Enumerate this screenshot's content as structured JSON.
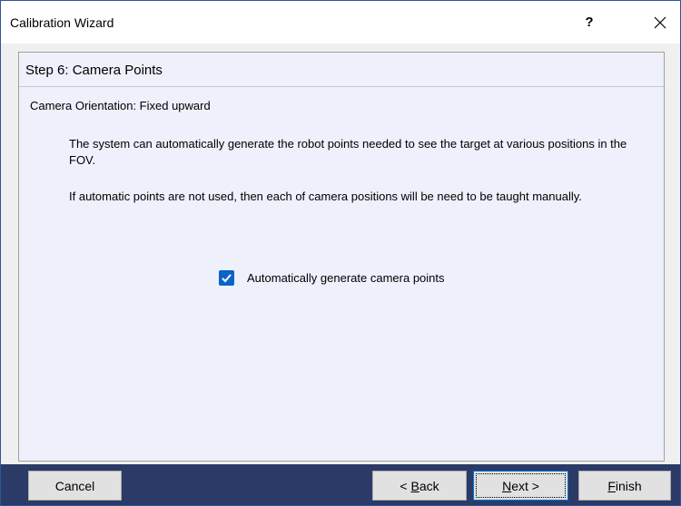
{
  "window": {
    "title": "Calibration Wizard",
    "help_label": "?",
    "close_icon": "close-icon"
  },
  "step": {
    "title": "Step 6: Camera Points",
    "orientation": "Camera Orientation: Fixed upward",
    "paragraph1": "The system can automatically generate the robot points needed to see the target at various positions in the FOV.",
    "paragraph2": "If automatic points are not used, then each of camera positions will be need to be taught manually."
  },
  "options": {
    "auto_generate": {
      "label": "Automatically generate camera points",
      "checked": true
    }
  },
  "buttons": {
    "cancel": "Cancel",
    "back_prefix": "< ",
    "back_accel": "B",
    "back_rest": "ack",
    "next_accel": "N",
    "next_rest": "ext >",
    "finish_accel": "F",
    "finish_rest": "inish"
  },
  "colors": {
    "accent": "#0a64c8",
    "footer": "#2b3a66",
    "content_bg": "#eef0fb"
  }
}
